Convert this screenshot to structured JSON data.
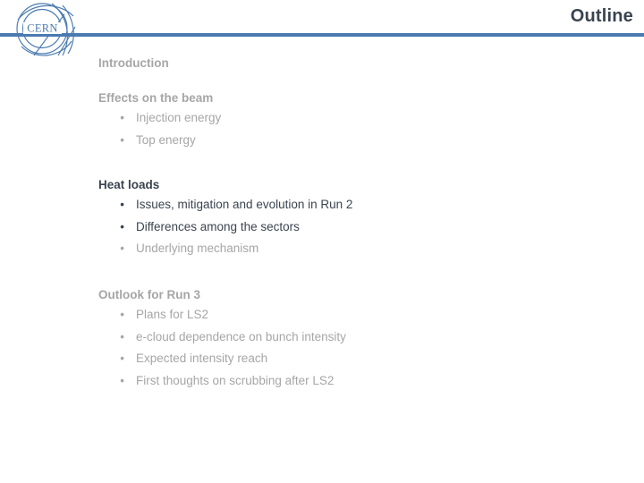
{
  "slide": {
    "title": "Outline",
    "title_color": "#3a4450",
    "rule_color": "#4a7ab0",
    "background": "#ffffff",
    "muted_color": "#a6a6a6",
    "strong_color": "#3a4450"
  },
  "logo": {
    "name": "cern-logo",
    "wordmark": "CERN",
    "color": "#4a7ab0"
  },
  "sections": [
    {
      "title": "Introduction",
      "tone": "muted",
      "bullets": []
    },
    {
      "title": "Effects on the beam",
      "tone": "muted",
      "bullets": [
        {
          "text": "Injection energy",
          "tone": "muted"
        },
        {
          "text": "Top energy",
          "tone": "muted"
        }
      ]
    },
    {
      "title": "Heat loads",
      "tone": "strong",
      "bullets": [
        {
          "text": "Issues, mitigation and evolution in Run 2",
          "tone": "strong"
        },
        {
          "text": "Differences among the sectors",
          "tone": "strong"
        },
        {
          "text": "Underlying mechanism",
          "tone": "muted"
        }
      ]
    },
    {
      "title": "Outlook for Run 3",
      "tone": "muted",
      "bullets": [
        {
          "text": "Plans for LS2",
          "tone": "muted"
        },
        {
          "text": "e-cloud dependence on bunch intensity",
          "tone": "muted"
        },
        {
          "text": "Expected intensity reach",
          "tone": "muted"
        },
        {
          "text": "First thoughts on scrubbing after LS2",
          "tone": "muted"
        }
      ]
    }
  ]
}
